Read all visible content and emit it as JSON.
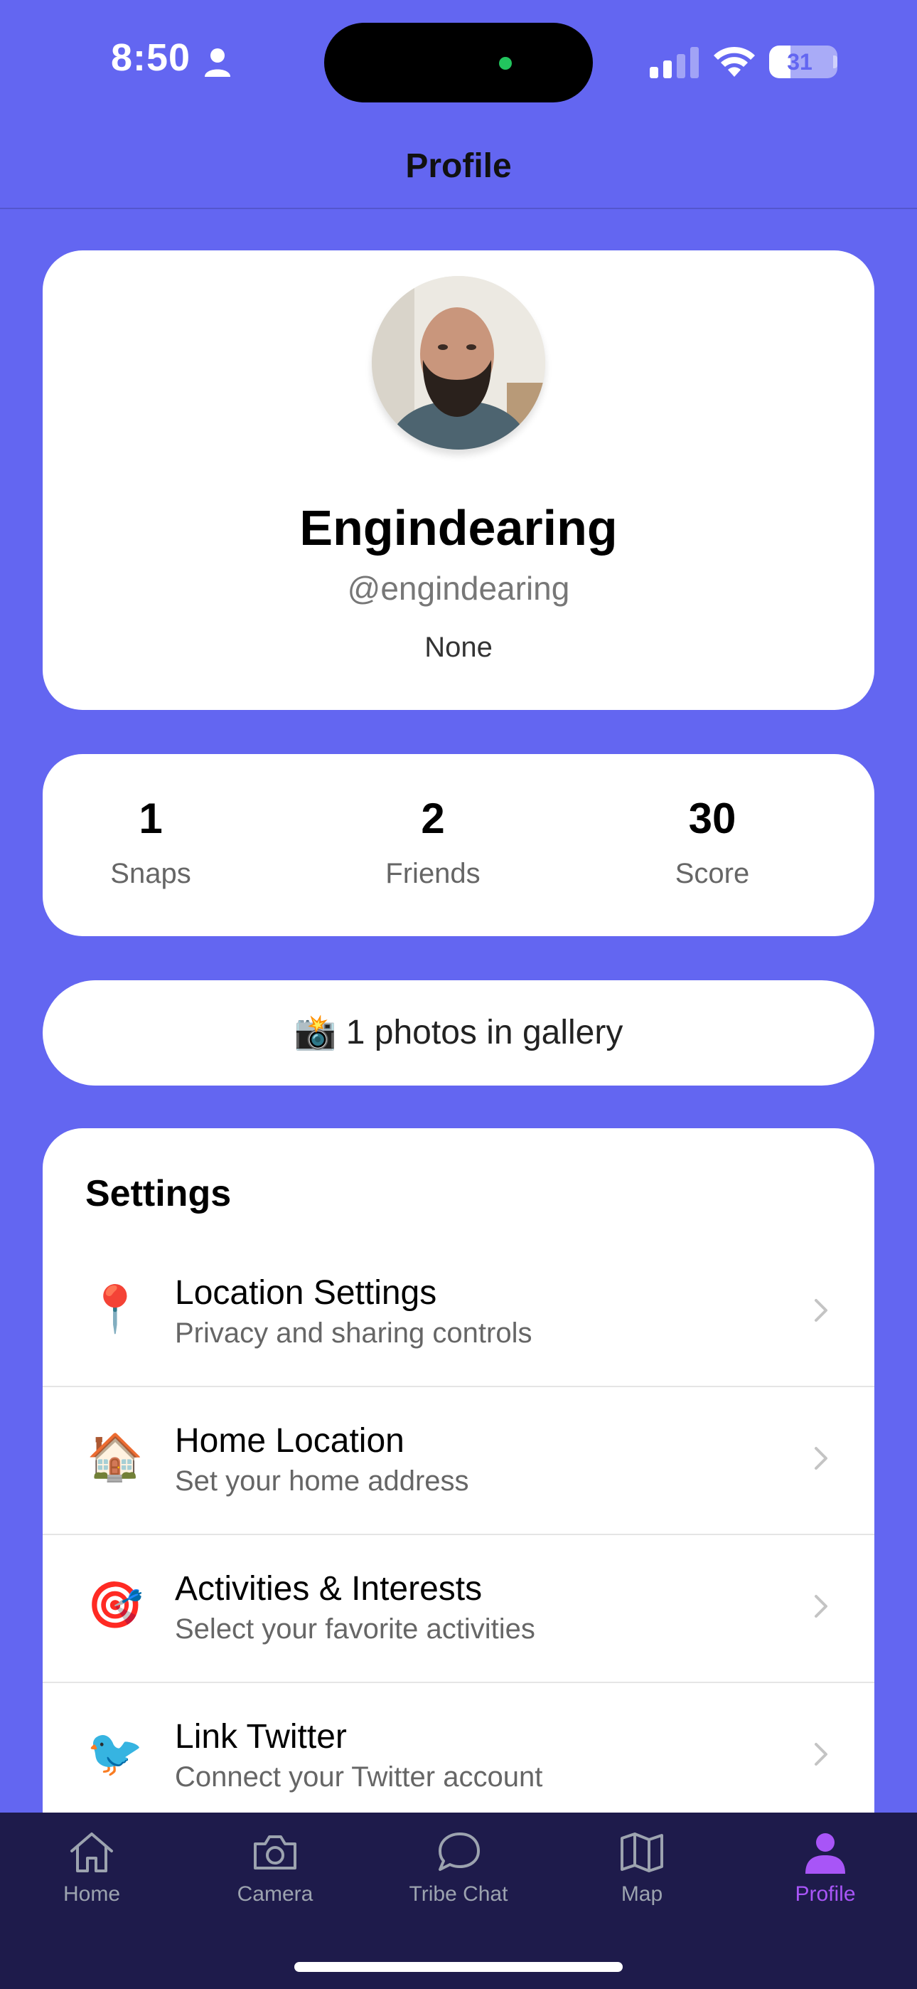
{
  "status_bar": {
    "time": "8:50",
    "battery": "31",
    "battery_level": 0.31
  },
  "header": {
    "title": "Profile"
  },
  "profile": {
    "name": "Engindearing",
    "handle": "@engindearing",
    "bio": "None"
  },
  "stats": [
    {
      "value": "1",
      "label": "Snaps"
    },
    {
      "value": "2",
      "label": "Friends"
    },
    {
      "value": "30",
      "label": "Score"
    }
  ],
  "gallery": {
    "text": "📸 1 photos in gallery"
  },
  "settings": {
    "title": "Settings",
    "items": [
      {
        "icon": "📍",
        "icon_name": "pushpin-icon",
        "title": "Location Settings",
        "subtitle": "Privacy and sharing controls"
      },
      {
        "icon": "🏠",
        "icon_name": "house-icon",
        "title": "Home Location",
        "subtitle": "Set your home address"
      },
      {
        "icon": "🎯",
        "icon_name": "target-icon",
        "title": "Activities & Interests",
        "subtitle": "Select your favorite activities"
      },
      {
        "icon": "🐦",
        "icon_name": "bird-icon",
        "title": "Link Twitter",
        "subtitle": "Connect your Twitter account"
      }
    ]
  },
  "tabs": [
    {
      "label": "Home",
      "icon": "home-icon",
      "active": false
    },
    {
      "label": "Camera",
      "icon": "camera-icon",
      "active": false
    },
    {
      "label": "Tribe Chat",
      "icon": "chat-bubble-icon",
      "active": false
    },
    {
      "label": "Map",
      "icon": "map-icon",
      "active": false
    },
    {
      "label": "Profile",
      "icon": "person-icon",
      "active": true
    }
  ],
  "colors": {
    "background": "#6366f1",
    "tab_bar": "#1e1b4b",
    "active_tab": "#a855f7",
    "inactive_tab": "#9ca3af"
  }
}
